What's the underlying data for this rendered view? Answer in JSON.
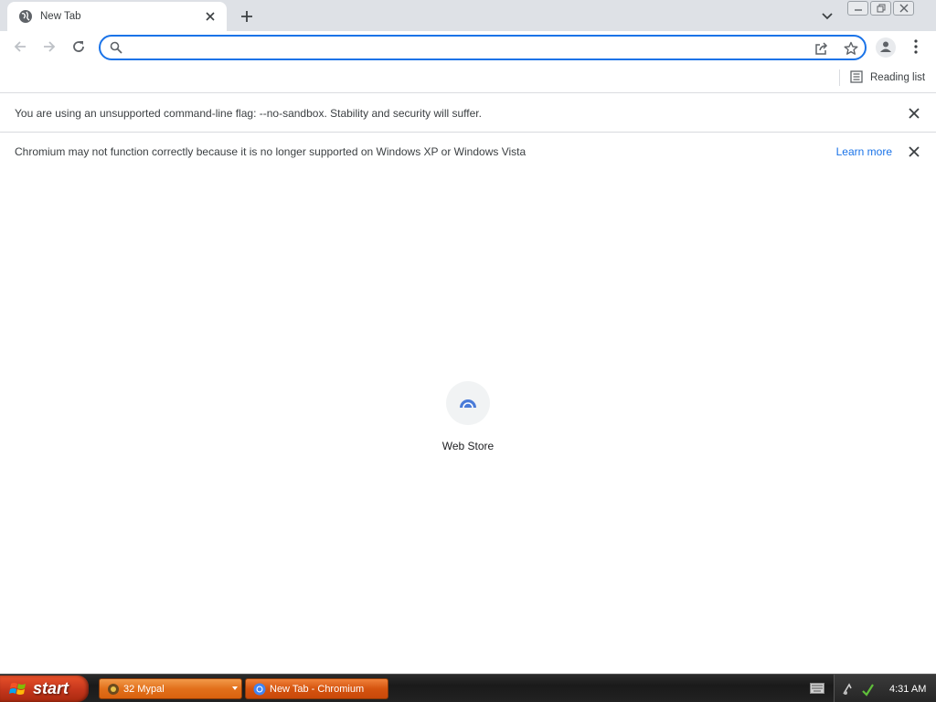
{
  "tab": {
    "title": "New Tab"
  },
  "omnibox": {
    "value": "",
    "placeholder": ""
  },
  "bookmarks_bar": {
    "reading_list": "Reading list"
  },
  "infobars": [
    {
      "message": "You are using an unsupported command-line flag: --no-sandbox. Stability and security will suffer."
    },
    {
      "message": "Chromium may not function correctly because it is no longer supported on Windows XP or Windows Vista",
      "link": "Learn more"
    }
  ],
  "shortcut": {
    "label": "Web Store"
  },
  "taskbar": {
    "start_label": "start",
    "items": [
      {
        "label": "32 Mypal"
      },
      {
        "label": "New Tab - Chromium"
      }
    ],
    "clock": "4:31 AM"
  },
  "colors": {
    "accent": "#1a73e8",
    "tabstrip": "#dee1e6",
    "xp_start": "#c4361c",
    "xp_task": "#e2701b"
  }
}
